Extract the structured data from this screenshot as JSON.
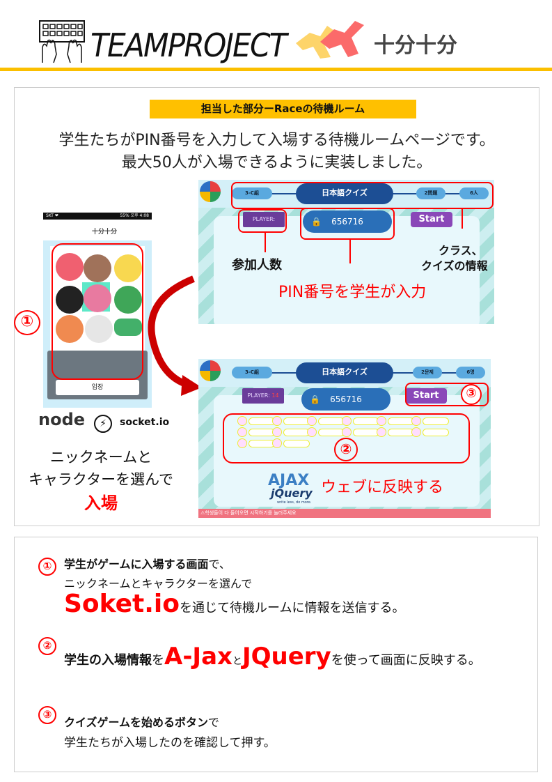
{
  "header": {
    "title": "TEAMPROJECT",
    "brand": "十分十分",
    "keyboard_icon": "keyboard-hands-icon"
  },
  "section": {
    "label": "担当した部分ーRaceの待機ルーム",
    "heading_line1": "学生たちがPIN番号を入力して入場する待機ルームページです。",
    "heading_line2": "最大50人が入場できるように実装しました。"
  },
  "room1": {
    "class": "3-C組",
    "quiz_title": "日本語クイズ",
    "questions": "2問題",
    "people": "6人",
    "player_label": "PLAYER:",
    "pin": "656716",
    "start": "Start"
  },
  "room2": {
    "class": "3-C組",
    "quiz_title": "日本語クイズ",
    "questions": "2문제",
    "people": "6명",
    "player_label": "PLAYER:",
    "player_count": "14",
    "pin": "656716",
    "start": "Start",
    "footer_notice": "⚠학생들이 다 들어오면 시작하기를 눌러주세요",
    "tech": "AJAX",
    "tech2": "jQuery",
    "tech2_tagline": "write less, do more."
  },
  "annotations": {
    "players": "参加人数",
    "pin": "PIN番号を学生が入力",
    "class_line1": "クラス、",
    "class_line2": "クイズの情報",
    "reflect": "ウェブに反映する"
  },
  "phone": {
    "status_left": "SKT ❤",
    "status_right": "55% 오후 4:08",
    "brand": "十分十分",
    "enter_button": "입장"
  },
  "left_caption": {
    "tech_node": "node",
    "tech_socket": "socket.io",
    "line1": "ニックネームと",
    "line2": "キャラクターを選んで",
    "line3": "入場"
  },
  "markers": {
    "one": "①",
    "two": "②",
    "three": "③"
  },
  "points": [
    {
      "num": "①",
      "bold": "学生がゲームに入場する画面",
      "rest": "で、",
      "line2": "ニックネームとキャラクターを選んで",
      "big": "Soket.io",
      "line3": "を通じて待機ルームに情報を送信する。"
    },
    {
      "num": "②",
      "bold": "学生の入場情報",
      "mid": "を",
      "big1": "A-Jax",
      "and": "と",
      "big2": "JQuery",
      "rest": "を使って画面に反映する。"
    },
    {
      "num": "③",
      "bold": "クイズゲームを始めるボタン",
      "rest": "で",
      "line2": "学生たちが入場したのを確認して押す。"
    }
  ],
  "colors": {
    "accent": "#fbbf00",
    "red": "#ff0000",
    "purple": "#6a3c9a",
    "blue": "#2a6fb8"
  }
}
